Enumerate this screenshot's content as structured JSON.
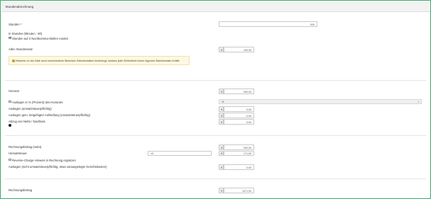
{
  "header": {
    "title": "Stundenabrechnung"
  },
  "hours": {
    "label": "Stunden *",
    "value": "000",
    "hint": "In Stunden (Minuten : 60)",
    "round_label": "Stunden auf 2 Nachkomma-Stellen runden"
  },
  "old_rate": {
    "label": "Alten Stundensatz",
    "currency": "€",
    "value": "150,00",
    "notice": "Hinweis: In der Akte sind verschiedene Benutzer Stundensätze hinterlegt, sodass jede Zeiteinheit einen eigenen Stundensatz erhält."
  },
  "fee": {
    "label": "Honorar",
    "currency": "€",
    "value": "900,00"
  },
  "expenses": {
    "percent_label": "Auslagen in % (Prozent) des Honorars",
    "percent_symbol": "%",
    "percent_sort": "⇕",
    "vat_label": "Auslagen (umsatzsteuerpflichtig)",
    "vat_value": "0,00",
    "reserve_label": "Auslagen gem. beigefügter Aufstellung (umsatzsteuerpflichtig)",
    "reserve_value": "0,00",
    "deduct_label": "Abzug von Netto / Nachlass",
    "deduct_value": "0,00",
    "currency": "€"
  },
  "totals": {
    "net_label": "Rechnungsbetrag (netto)",
    "net_value": "900,00",
    "vat_label": "Umsatzsteuer",
    "vat_rate": "19",
    "vat_value": "171,00",
    "reverse_label": "Reverse-Charge Hinweis in Rechnung ergänzen",
    "extra_label": "Auslagen (nicht umsatzsteuerpflichtig, etwa vorausgelegte Gerichtskosten)",
    "extra_value": "0,00",
    "gross_label": "Rechnungsbetrag",
    "gross_value": "1071,00",
    "currency": "€"
  },
  "colors": {
    "frame": "#3aa86b",
    "notice_bg": "#fcf8e3",
    "notice_text": "#8a6d3b"
  }
}
